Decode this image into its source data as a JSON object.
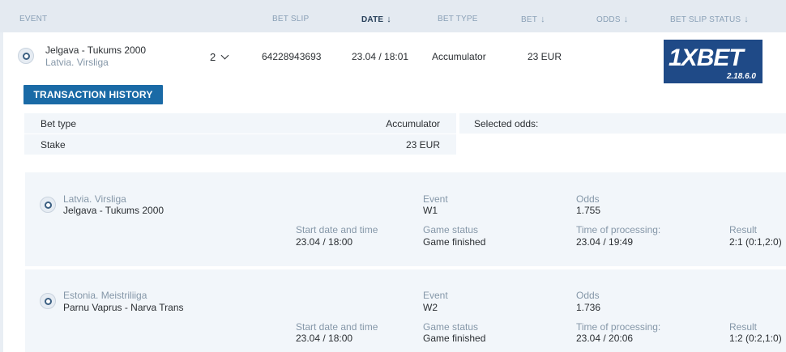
{
  "columns": {
    "event": "EVENT",
    "bet_slip": "BET SLIP",
    "date": "DATE",
    "bet_type": "BET TYPE",
    "bet": "BET",
    "odds": "ODDS",
    "status": "BET SLIP STATUS"
  },
  "row": {
    "match": "Jelgava - Tukums 2000",
    "league": "Latvia. Virsliga",
    "count": "2",
    "slip_id": "64228943693",
    "date": "23.04 / 18:01",
    "bet_type": "Accumulator",
    "bet": "23 EUR"
  },
  "logo": {
    "text": "1XBET",
    "version": "2.18.6.0"
  },
  "transaction_button": "TRANSACTION HISTORY",
  "summary": {
    "bet_type_label": "Bet type",
    "bet_type_value": "Accumulator",
    "stake_label": "Stake",
    "stake_value": "23 EUR",
    "selected_odds_label": "Selected odds:"
  },
  "labels": {
    "event": "Event",
    "odds": "Odds",
    "start": "Start date and time",
    "game_status": "Game status",
    "processing": "Time of processing:",
    "result": "Result"
  },
  "events": [
    {
      "league": "Latvia. Virsliga",
      "match": "Jelgava - Tukums 2000",
      "event": "W1",
      "odds": "1.755",
      "start": "23.04 / 18:00",
      "status": "Game finished",
      "processing": "23.04 / 19:49",
      "result": "2:1 (0:1,2:0)"
    },
    {
      "league": "Estonia. Meistriliiga",
      "match": "Parnu Vaprus - Narva Trans",
      "event": "W2",
      "odds": "1.736",
      "start": "23.04 / 18:00",
      "status": "Game finished",
      "processing": "23.04 / 20:06",
      "result": "1:2 (0:2,1:0)"
    }
  ]
}
